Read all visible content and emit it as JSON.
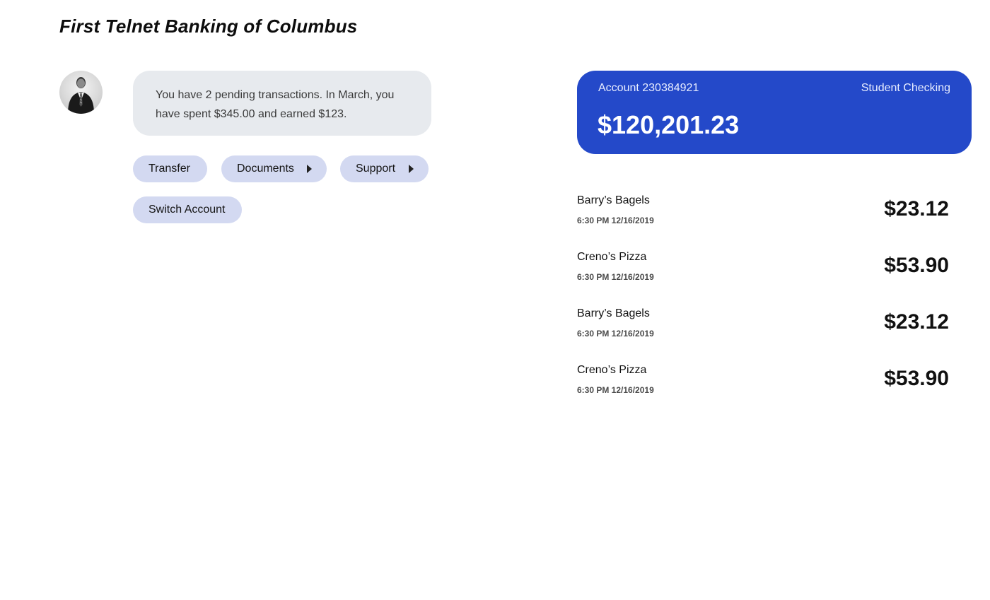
{
  "app": {
    "title": "First Telnet Banking of Columbus"
  },
  "assistant": {
    "message": "You have 2 pending transactions. In March, you have spent $345.00 and earned $123.",
    "quick_actions": [
      {
        "label": "Transfer",
        "has_submenu": false
      },
      {
        "label": "Documents",
        "has_submenu": true
      },
      {
        "label": "Support",
        "has_submenu": true
      },
      {
        "label": "Switch Account",
        "has_submenu": false
      }
    ]
  },
  "account": {
    "number_label": "Account 230384921",
    "type": "Student Checking",
    "balance": "$120,201.23"
  },
  "transactions": [
    {
      "merchant": "Barry’s Bagels",
      "time": "6:30 PM 12/16/2019",
      "amount": "$23.12"
    },
    {
      "merchant": "Creno’s Pizza",
      "time": "6:30 PM 12/16/2019",
      "amount": "$53.90"
    },
    {
      "merchant": "Barry’s Bagels",
      "time": "6:30 PM 12/16/2019",
      "amount": "$23.12"
    },
    {
      "merchant": "Creno’s Pizza",
      "time": "6:30 PM 12/16/2019",
      "amount": "$53.90"
    }
  ],
  "colors": {
    "accent": "#2449c9",
    "chip": "#d3d9f1",
    "bubble": "#e7eaee"
  },
  "icons": {
    "avatar": "user-avatar-photo",
    "submenu": "caret-right-icon"
  }
}
